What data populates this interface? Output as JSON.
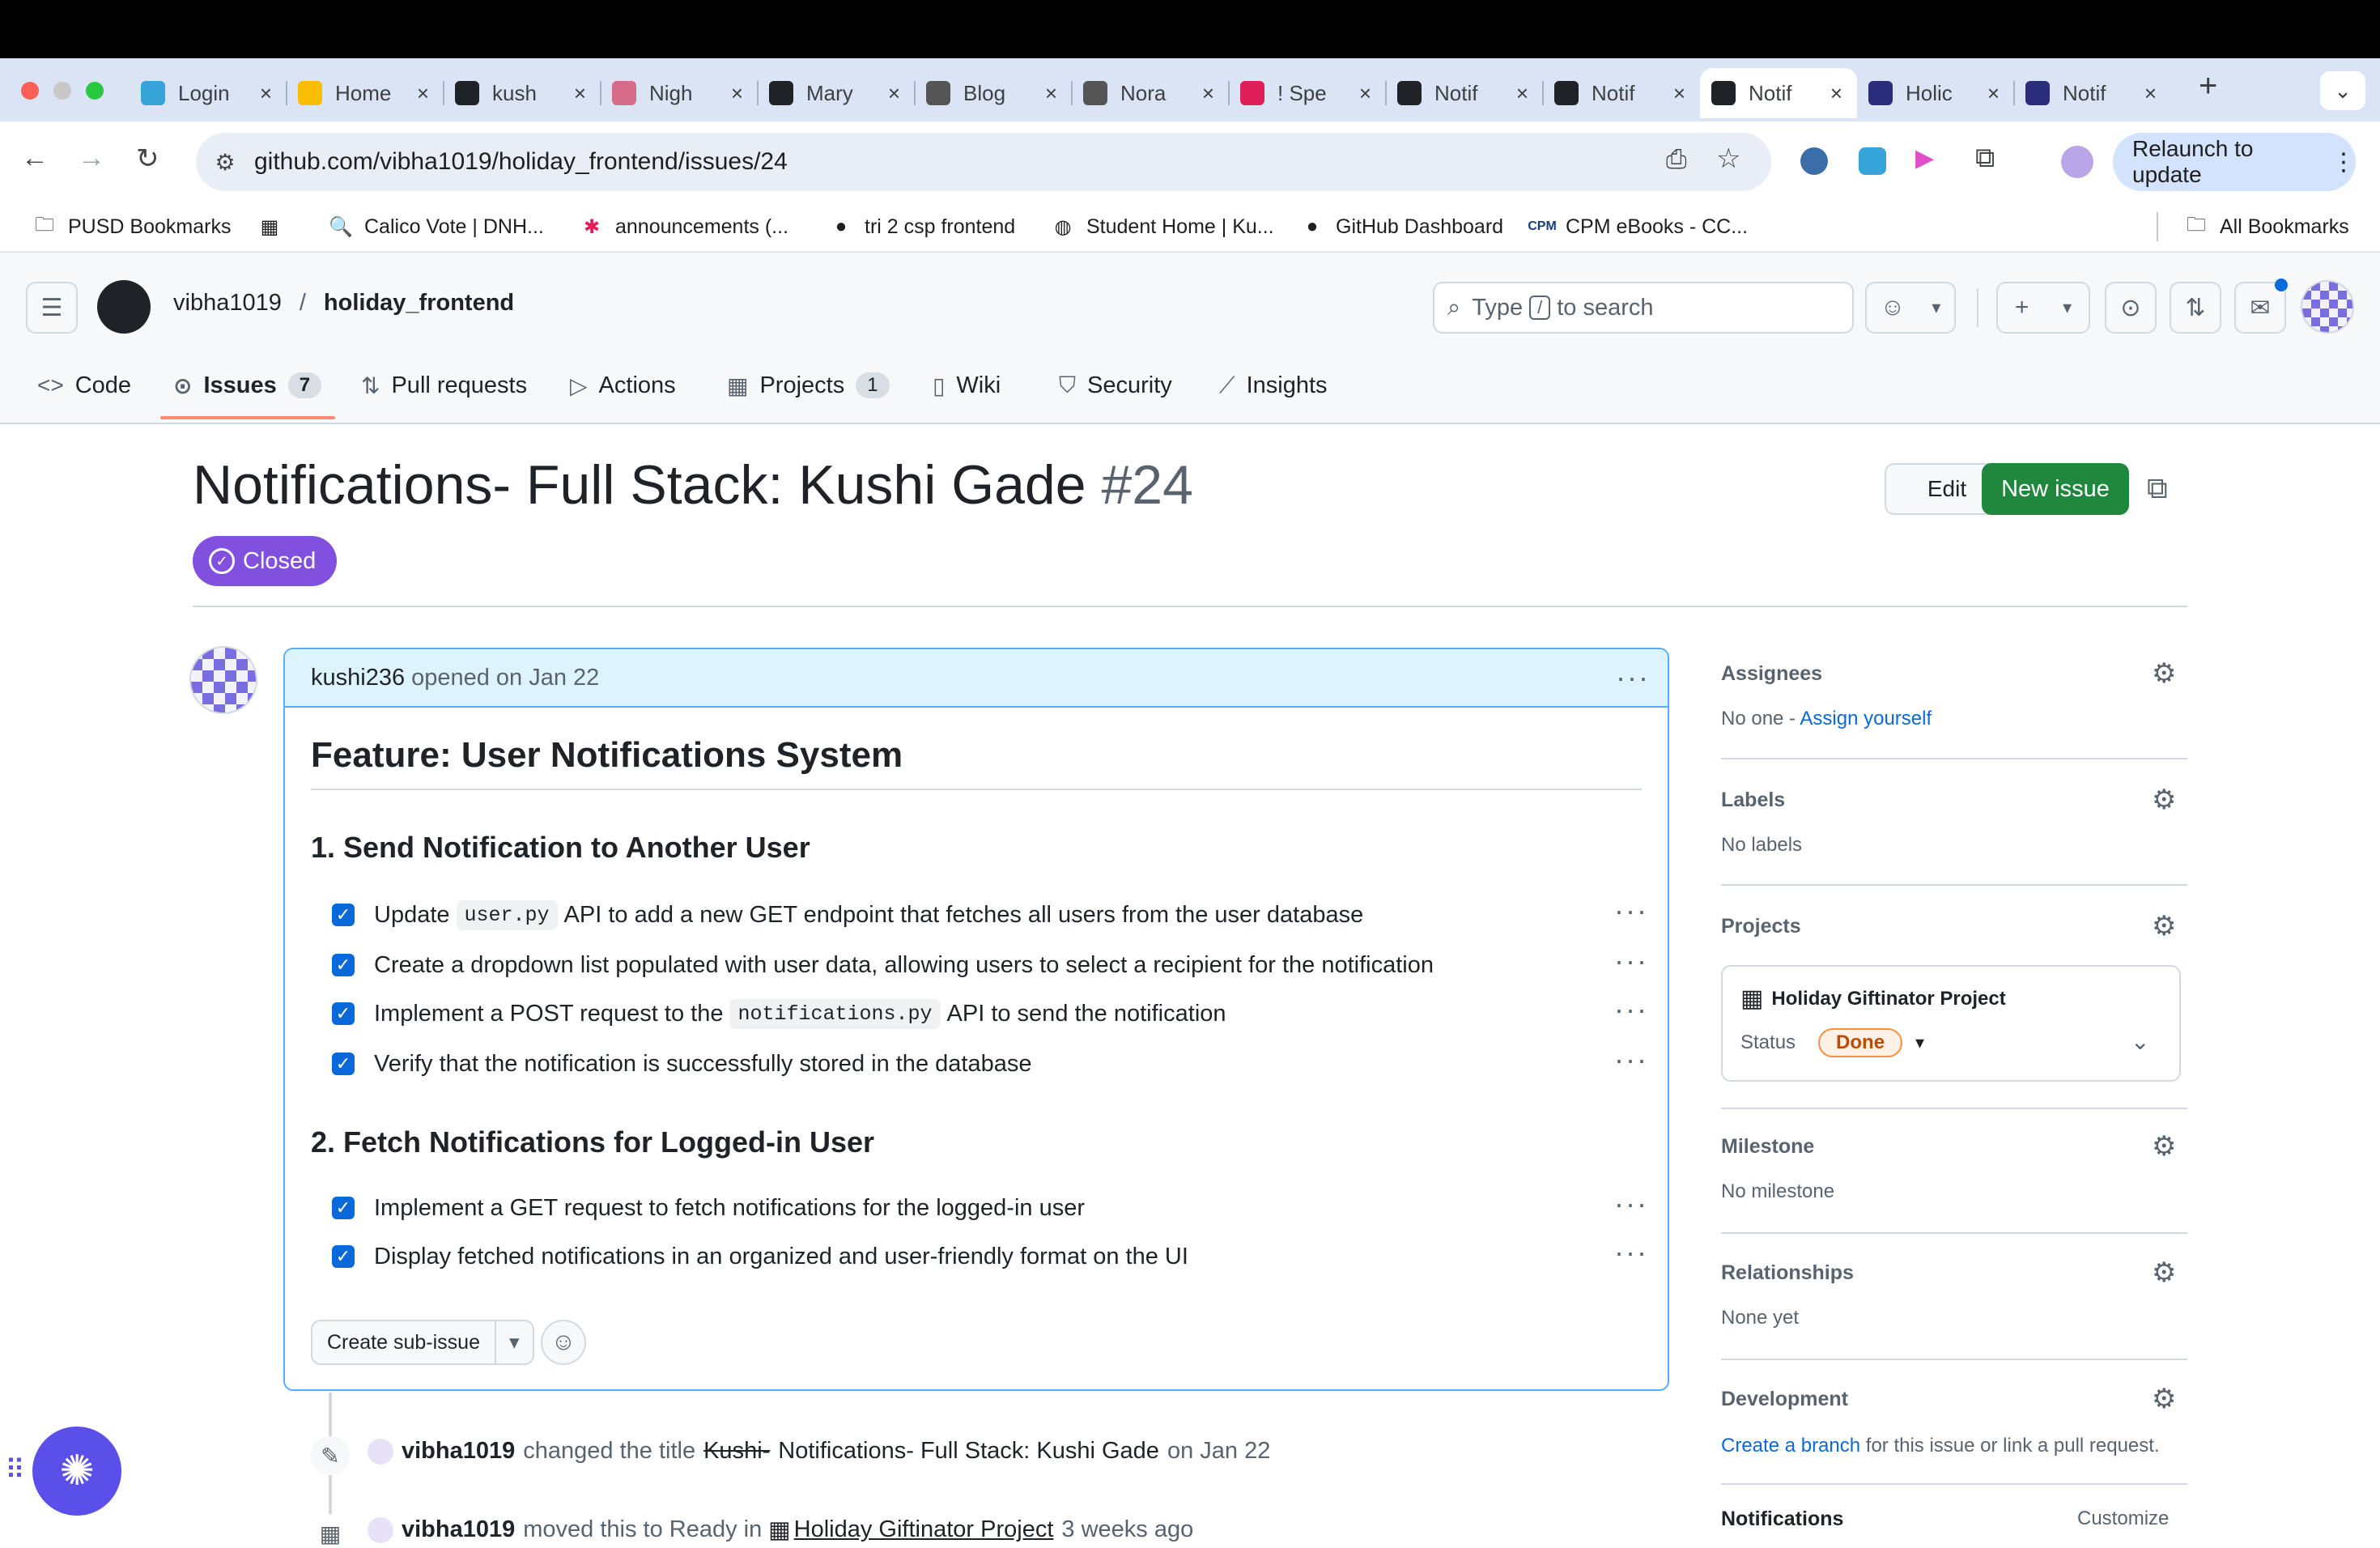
{
  "browser": {
    "tabs": [
      {
        "title": "Login",
        "icon": "cloud-icon",
        "color": "#36a3d9"
      },
      {
        "title": "Home",
        "icon": "drive-icon",
        "color": "#fbbc04"
      },
      {
        "title": "kush",
        "icon": "github-icon",
        "color": "#1f2328"
      },
      {
        "title": "Nigh",
        "icon": "flower-icon",
        "color": "#d66b8a"
      },
      {
        "title": "Mary",
        "icon": "github-icon",
        "color": "#1f2328"
      },
      {
        "title": "Blog",
        "icon": "search-icon",
        "color": "#555555"
      },
      {
        "title": "Nora",
        "icon": "globe-icon",
        "color": "#555555"
      },
      {
        "title": "! Spe",
        "icon": "slack-icon",
        "color": "#e01e5a"
      },
      {
        "title": "Notif",
        "icon": "openai-icon",
        "color": "#1f2328"
      },
      {
        "title": "Notif",
        "icon": "github-icon",
        "color": "#1f2328"
      },
      {
        "title": "Notif",
        "icon": "github-icon",
        "color": "#1f2328",
        "active": true
      },
      {
        "title": "Holic",
        "icon": "app-icon",
        "color": "#2b2d7c"
      },
      {
        "title": "Notif",
        "icon": "app-icon",
        "color": "#2b2d7c"
      }
    ],
    "url": "github.com/vibha1019/holiday_frontend/issues/24",
    "relaunch_label": "Relaunch to update",
    "bookmarks": [
      {
        "label": "PUSD Bookmarks",
        "icon": "folder-icon"
      },
      {
        "label": "Calico Vote | DNH...",
        "icon": "search-icon"
      },
      {
        "label": "announcements (...",
        "icon": "slack-icon"
      },
      {
        "label": "tri 2 csp frontend",
        "icon": "github-icon"
      },
      {
        "label": "Student Home | Ku...",
        "icon": "globe-icon"
      },
      {
        "label": "GitHub Dashboard",
        "icon": "github-icon"
      },
      {
        "label": "CPM eBooks - CC...",
        "icon": "cpm-icon"
      }
    ],
    "all_bookmarks_label": "All Bookmarks"
  },
  "github": {
    "owner": "vibha1019",
    "separator": "/",
    "repo": "holiday_frontend",
    "search_placeholder_pre": "Type",
    "search_key": "/",
    "search_placeholder_post": "to search",
    "nav": [
      {
        "label": "Code",
        "icon": "code-icon"
      },
      {
        "label": "Issues",
        "icon": "issue-icon",
        "count": "7",
        "active": true
      },
      {
        "label": "Pull requests",
        "icon": "pull-request-icon"
      },
      {
        "label": "Actions",
        "icon": "play-icon"
      },
      {
        "label": "Projects",
        "icon": "table-icon",
        "count": "1"
      },
      {
        "label": "Wiki",
        "icon": "book-icon"
      },
      {
        "label": "Security",
        "icon": "shield-icon"
      },
      {
        "label": "Insights",
        "icon": "graph-icon"
      }
    ]
  },
  "issue": {
    "title": "Notifications- Full Stack: Kushi Gade",
    "number": "#24",
    "state": "Closed",
    "edit_label": "Edit",
    "new_issue_label": "New issue",
    "author": "kushi236",
    "opened_text": "opened on Jan 22",
    "heading": "Feature: User Notifications System",
    "section1": "1. Send Notification to Another User",
    "tasks1": [
      {
        "pre": "Update",
        "code": "user.py",
        "post": "API to add a new GET endpoint that fetches all users from the user database"
      },
      {
        "pre": "Create a dropdown list populated with user data, allowing users to select a recipient for the notification",
        "code": "",
        "post": ""
      },
      {
        "pre": "Implement a POST request to the",
        "code": "notifications.py",
        "post": "API to send the notification"
      },
      {
        "pre": "Verify that the notification is successfully stored in the database",
        "code": "",
        "post": ""
      }
    ],
    "section2": "2. Fetch Notifications for Logged-in User",
    "tasks2": [
      {
        "pre": "Implement a GET request to fetch notifications for the logged-in user"
      },
      {
        "pre": "Display fetched notifications in an organized and user-friendly format on the UI"
      }
    ],
    "sub_issue_label": "Create sub-issue",
    "timeline": [
      {
        "actor": "vibha1019",
        "action": "changed the title",
        "old_title": "Kushi-",
        "new_title": "Notifications- Full Stack: Kushi Gade",
        "when": "on Jan 22"
      },
      {
        "actor": "vibha1019",
        "action": "moved this to Ready in",
        "project": "Holiday Giftinator Project",
        "when": "3 weeks ago"
      }
    ]
  },
  "sidebar": {
    "assignees_title": "Assignees",
    "assignees_none": "No one -",
    "assign_yourself": "Assign yourself",
    "labels_title": "Labels",
    "labels_value": "No labels",
    "projects_title": "Projects",
    "project_name": "Holiday Giftinator Project",
    "status_label": "Status",
    "status_value": "Done",
    "milestone_title": "Milestone",
    "milestone_value": "No milestone",
    "relationships_title": "Relationships",
    "relationships_value": "None yet",
    "development_title": "Development",
    "create_branch": "Create a branch",
    "development_text": "for this issue or link a pull request.",
    "notifications_title": "Notifications",
    "customize_label": "Customize"
  }
}
